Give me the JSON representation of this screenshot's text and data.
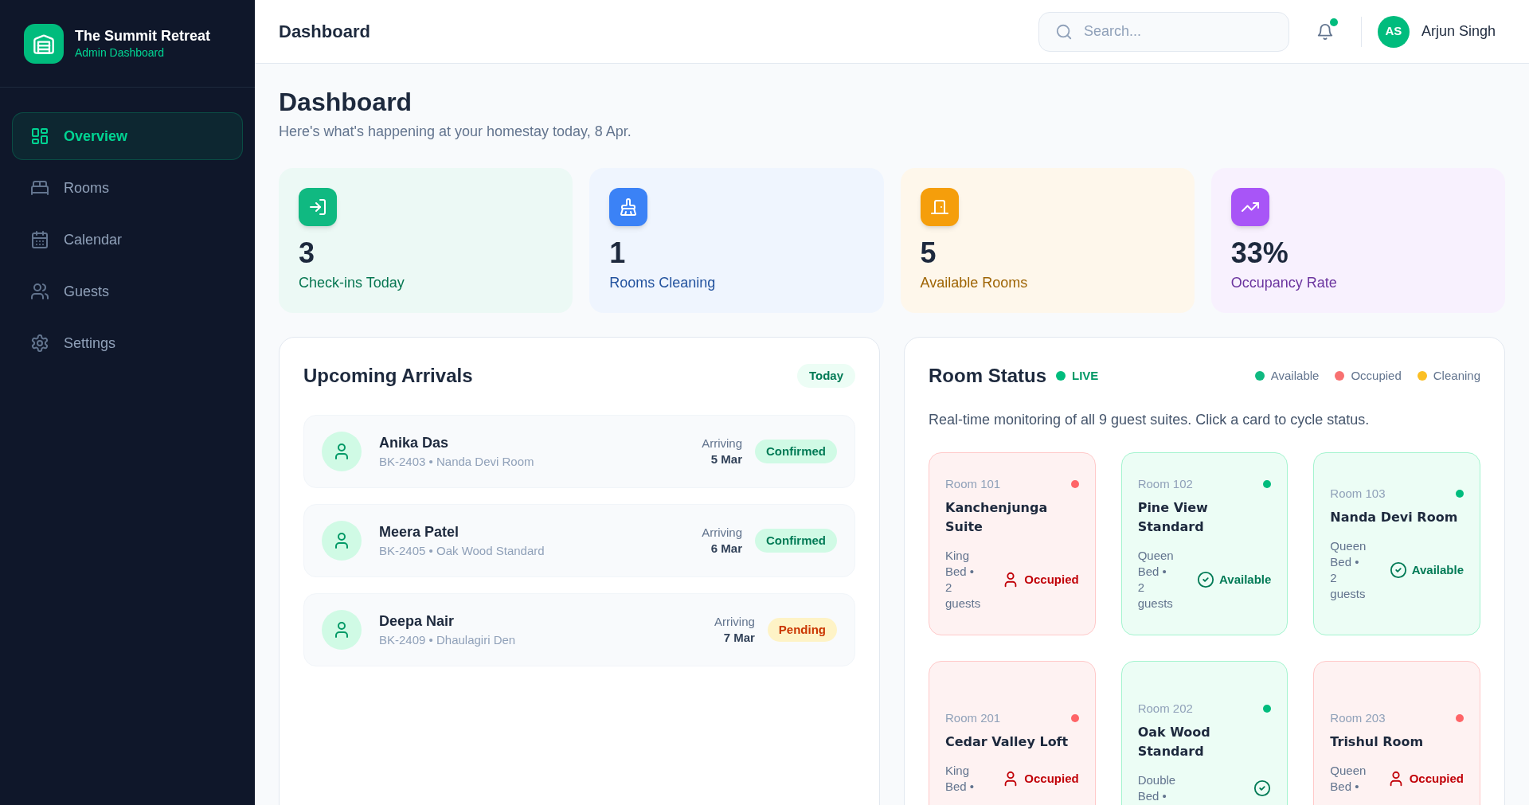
{
  "sidebar": {
    "brand": {
      "title": "The Summit Retreat",
      "subtitle": "Admin Dashboard"
    },
    "nav": [
      {
        "label": "Overview",
        "selected": true
      },
      {
        "label": "Rooms",
        "selected": false
      },
      {
        "label": "Calendar",
        "selected": false
      },
      {
        "label": "Guests",
        "selected": false
      },
      {
        "label": "Settings",
        "selected": false
      }
    ]
  },
  "header": {
    "title": "Dashboard",
    "search": {
      "placeholder": "Search..."
    },
    "notifications": {
      "unread": true
    },
    "user": {
      "initials": "AS",
      "name": "Arjun Singh"
    }
  },
  "page": {
    "title": "Dashboard",
    "subtitle": "Here's what's happening at your homestay today, 8 Apr."
  },
  "stats": [
    {
      "value": "3",
      "label": "Check-ins Today",
      "color": "#10b981"
    },
    {
      "value": "1",
      "label": "Rooms Cleaning",
      "color": "#3b82f6"
    },
    {
      "value": "5",
      "label": "Available Rooms",
      "color": "#f59e0b"
    },
    {
      "value": "33%",
      "label": "Occupancy Rate",
      "color": "#a855f7"
    }
  ],
  "arrivals": {
    "title": "Upcoming Arrivals",
    "badge": "Today",
    "items": [
      {
        "name": "Anika Das",
        "booking": "BK-2403 • Nanda Devi Room",
        "arriving_label": "Arriving",
        "date": "5 Mar",
        "status": {
          "label": "Confirmed",
          "kind": "confirmed"
        }
      },
      {
        "name": "Meera Patel",
        "booking": "BK-2405 • Oak Wood Standard",
        "arriving_label": "Arriving",
        "date": "6 Mar",
        "status": {
          "label": "Confirmed",
          "kind": "confirmed"
        }
      },
      {
        "name": "Deepa Nair",
        "booking": "BK-2409 • Dhaulagiri Den",
        "arriving_label": "Arriving",
        "date": "7 Mar",
        "status": {
          "label": "Pending",
          "kind": "pending"
        }
      }
    ]
  },
  "room_status": {
    "title": "Room Status",
    "live": "LIVE",
    "legend": [
      {
        "label": "Available",
        "color": "#10b981"
      },
      {
        "label": "Occupied",
        "color": "#f87171"
      },
      {
        "label": "Cleaning",
        "color": "#fbbf24"
      }
    ],
    "description": "Real-time monitoring of all 9 guest suites. Click a card to cycle status.",
    "rooms": [
      {
        "number": "Room 101",
        "name": "Kanchenjunga Suite",
        "details": "King Bed • 2 guests",
        "status": {
          "kind": "occupied",
          "label": "Occupied"
        }
      },
      {
        "number": "Room 102",
        "name": "Pine View Standard",
        "details": "Queen Bed • 2 guests",
        "status": {
          "kind": "available",
          "label": "Available"
        }
      },
      {
        "number": "Room 103",
        "name": "Nanda Devi Room",
        "details": "Queen Bed • 2 guests",
        "status": {
          "kind": "available",
          "label": "Available"
        }
      },
      {
        "number": "Room 201",
        "name": "Cedar Valley Loft",
        "details": "King Bed •",
        "status": {
          "kind": "occupied",
          "label": "Occupied"
        }
      },
      {
        "number": "Room 202",
        "name": "Oak Wood Standard",
        "details": "Double Bed •",
        "status": {
          "kind": "available"
        }
      },
      {
        "number": "Room 203",
        "name": "Trishul Room",
        "details": "Queen Bed •",
        "status": {
          "kind": "occupied",
          "label": "Occupied"
        }
      }
    ]
  }
}
